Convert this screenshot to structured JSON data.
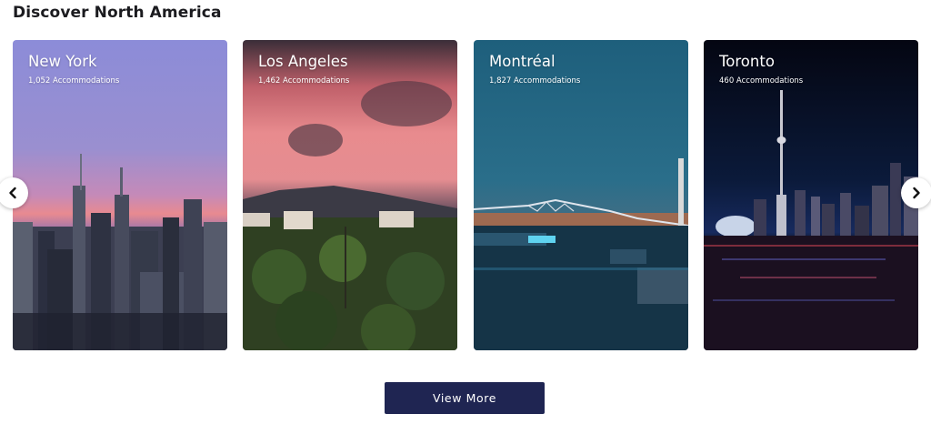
{
  "section": {
    "title": "Discover North America"
  },
  "cards": [
    {
      "name": "New York",
      "count": "1,052 Accommodations"
    },
    {
      "name": "Los Angeles",
      "count": "1,462 Accommodations"
    },
    {
      "name": "Montréal",
      "count": "1,827 Accommodations"
    },
    {
      "name": "Toronto",
      "count": "460 Accommodations"
    }
  ],
  "carousel": {
    "prev_icon": "chevron-left-icon",
    "next_icon": "chevron-right-icon"
  },
  "actions": {
    "view_more_label": "View More"
  },
  "colors": {
    "button_bg": "#1f2552",
    "heading": "#1b1b1f"
  }
}
